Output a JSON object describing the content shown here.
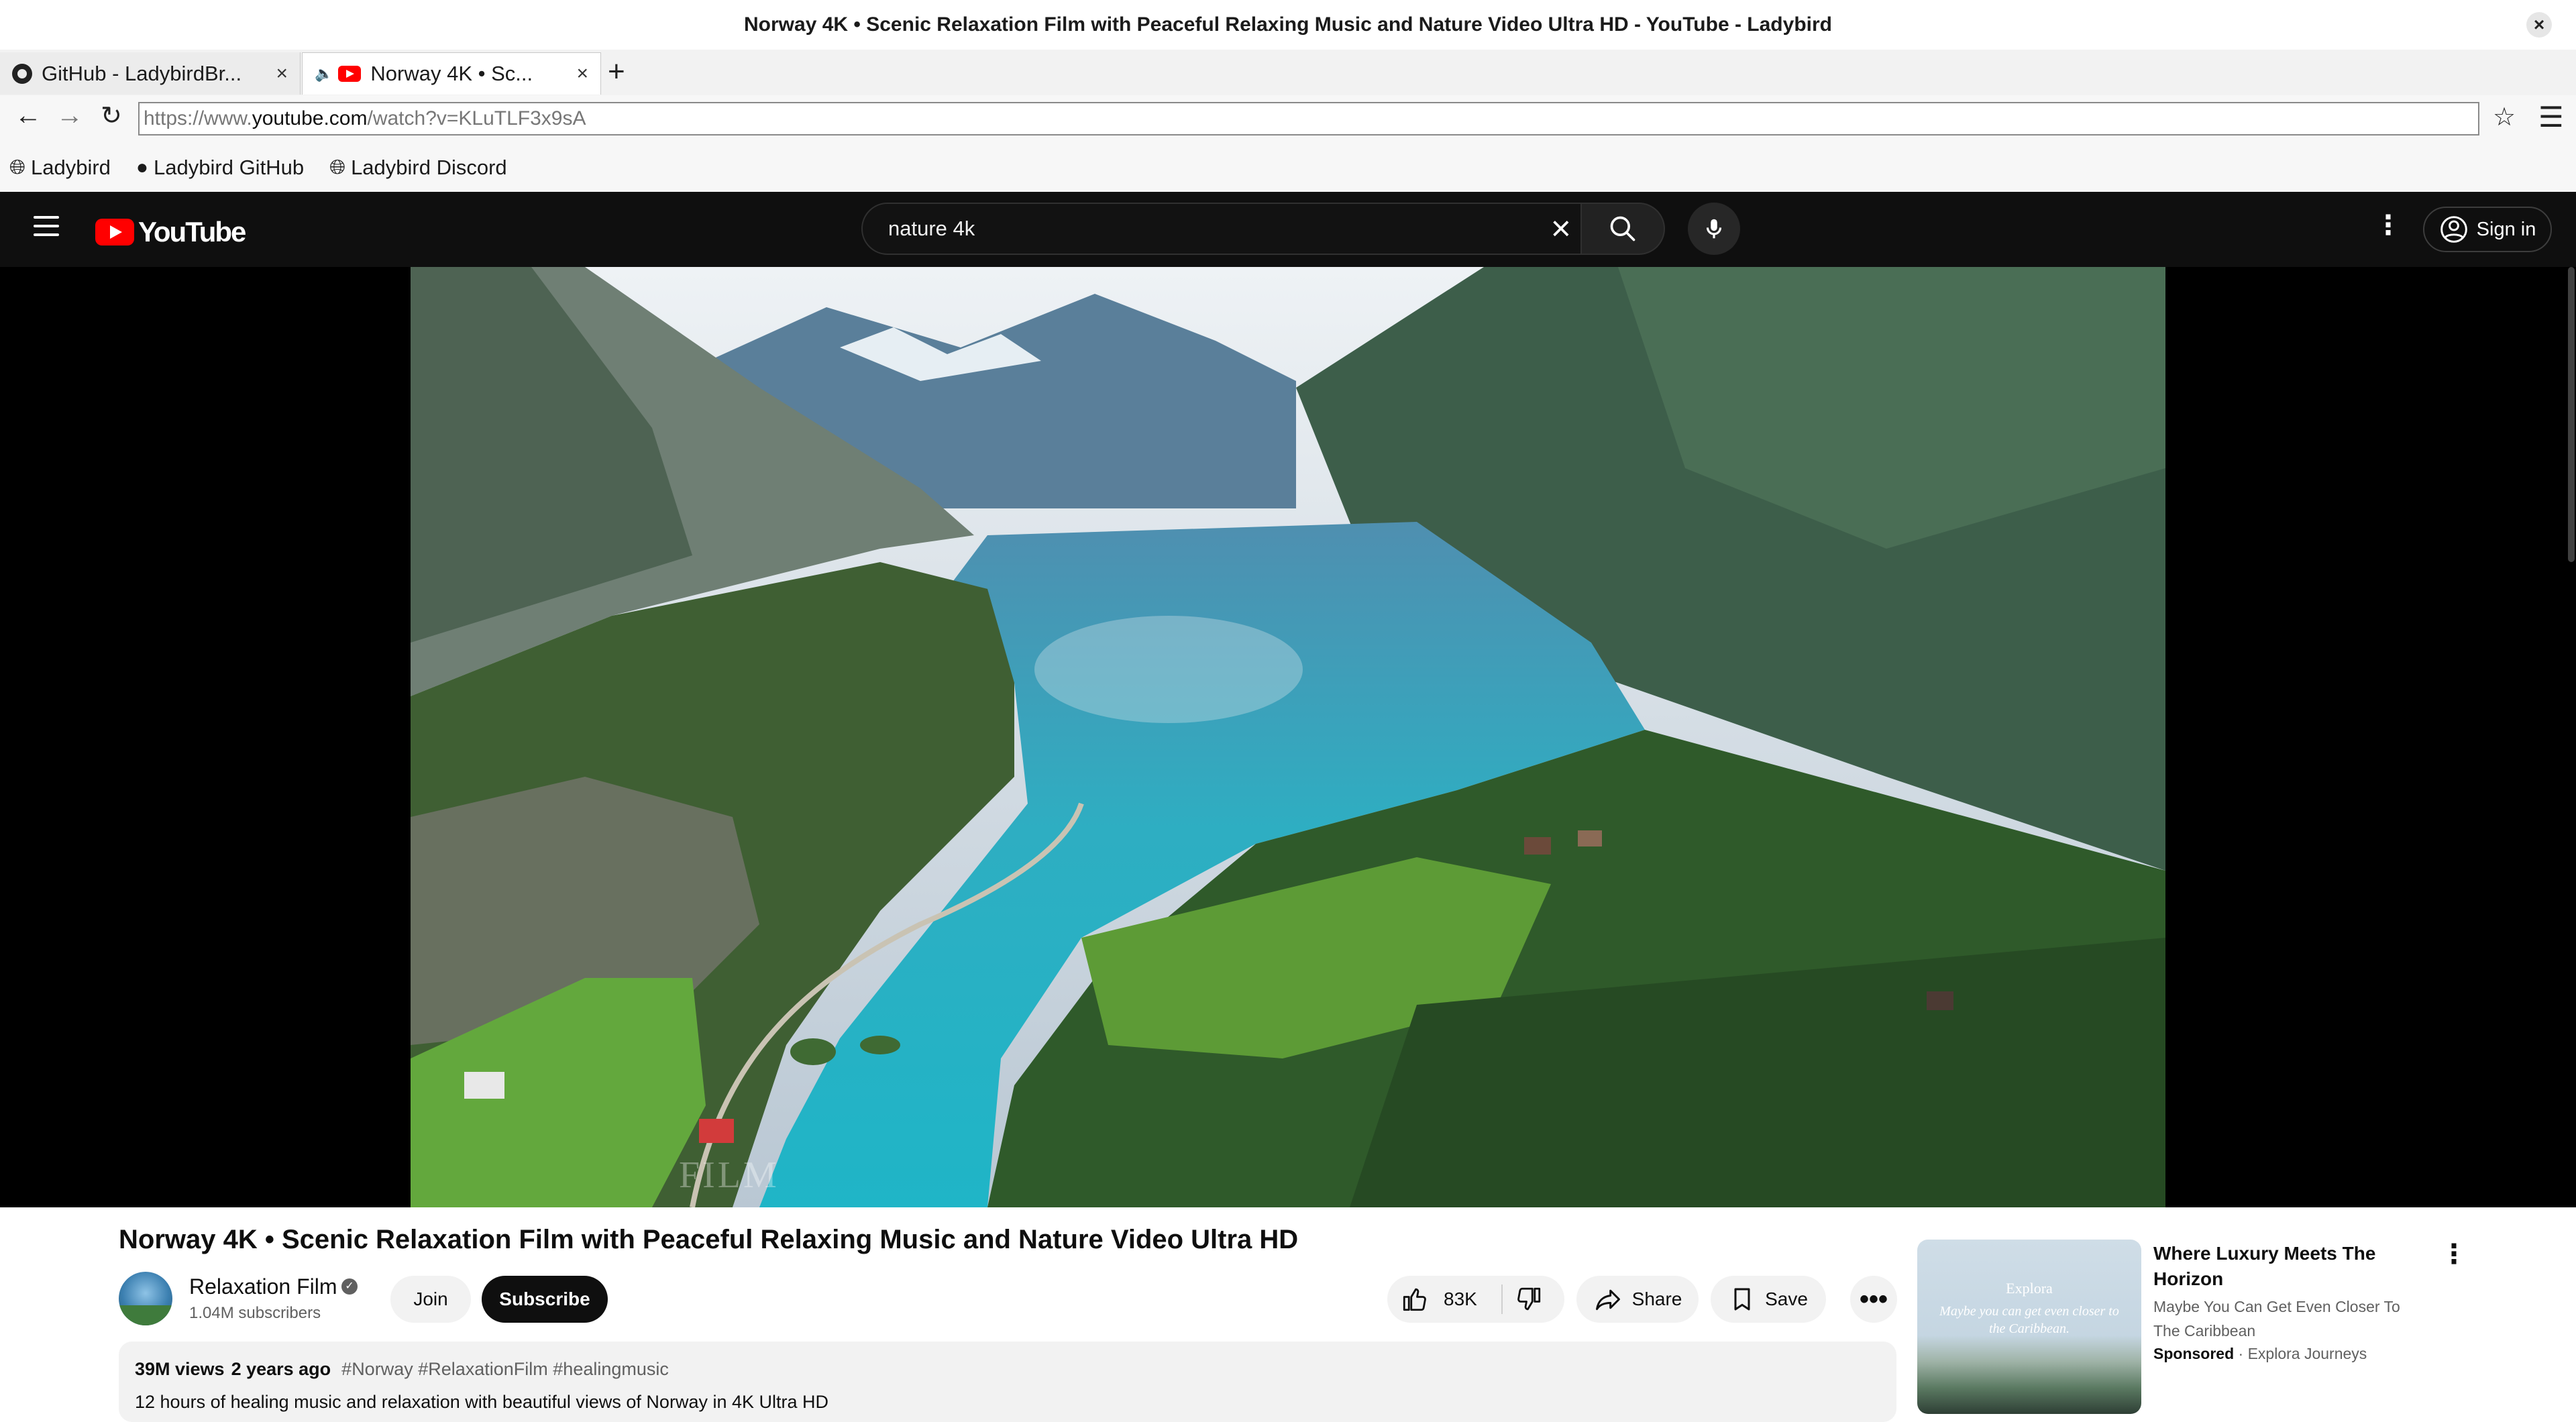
{
  "window": {
    "title": "Norway 4K • Scenic Relaxation Film with Peaceful Relaxing Music and Nature Video Ultra HD - YouTube - Ladybird",
    "close_label": "×"
  },
  "tabs": [
    {
      "label": "GitHub - LadybirdBr...",
      "close": "×",
      "icon": "github-icon",
      "active": false
    },
    {
      "label": "Norway 4K • Sc...",
      "close": "×",
      "icon": "youtube-favicon",
      "active": true,
      "playing_audio": true
    }
  ],
  "new_tab_label": "+",
  "address": {
    "scheme": "https://www.",
    "host": "youtube.com",
    "path": "/watch?v=KLuTLF3x9sA"
  },
  "bookmarks": [
    {
      "label": "Ladybird",
      "icon": "globe-icon"
    },
    {
      "label": "Ladybird GitHub",
      "icon": "github-icon"
    },
    {
      "label": "Ladybird Discord",
      "icon": "globe-icon"
    }
  ],
  "masthead": {
    "logo_text": "YouTube",
    "search_value": "nature 4k",
    "signin_label": "Sign in"
  },
  "video": {
    "title": "Norway 4K • Scenic Relaxation Film with Peaceful Relaxing Music and Nature Video Ultra HD",
    "watermark": "FILM"
  },
  "channel": {
    "name": "Relaxation Film",
    "subscribers": "1.04M subscribers",
    "join_label": "Join",
    "subscribe_label": "Subscribe"
  },
  "actions": {
    "likes": "83K",
    "share_label": "Share",
    "save_label": "Save",
    "more_label": "•••"
  },
  "description": {
    "views": "39M views",
    "age": "2 years ago",
    "tags": "#Norway #RelaxationFilm #healingmusic",
    "summary": "12 hours of healing music and relaxation with beautiful views of Norway in 4K Ultra HD"
  },
  "ad": {
    "title": "Where Luxury Meets The Horizon",
    "description": "Maybe You Can Get Even Closer To The Caribbean",
    "sponsored_label": "Sponsored",
    "separator": "·",
    "advertiser": "Explora Journeys",
    "thumb_brand": "Explora",
    "thumb_tagline": "Maybe you can get even closer to the Caribbean.",
    "more_label": "⋮"
  },
  "colors": {
    "brand_red": "#ff0000",
    "masthead_bg": "#0f0f0f",
    "lake": "#2fb6c6",
    "forest": "#2f5a2a"
  }
}
